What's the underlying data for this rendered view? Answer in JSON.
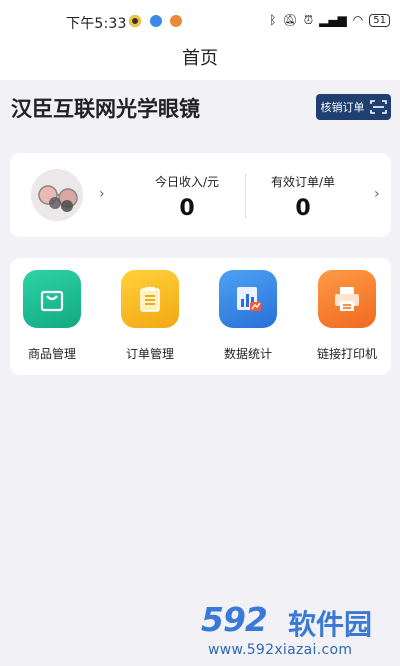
{
  "status_bar": {
    "time": "下午5:33",
    "battery": "51"
  },
  "nav": {
    "title": "首页"
  },
  "header": {
    "store_name": "汉臣互联网光学眼镜",
    "verify_button": "核销订单"
  },
  "stats": [
    {
      "label": "今日收入/元",
      "value": "0"
    },
    {
      "label": "有效订单/单",
      "value": "0"
    }
  ],
  "menu": [
    {
      "label": "商品管理",
      "icon": "shopping-bag-icon",
      "color": "#1bbf95"
    },
    {
      "label": "订单管理",
      "icon": "clipboard-icon",
      "color": "#f6b81e"
    },
    {
      "label": "数据统计",
      "icon": "bar-chart-icon",
      "color": "#3a8ae6"
    },
    {
      "label": "链接打印机",
      "icon": "printer-icon",
      "color": "#f27a2c"
    }
  ],
  "watermark": {
    "number": "592",
    "name": "软件园",
    "url": "www.592xiazai.com"
  }
}
